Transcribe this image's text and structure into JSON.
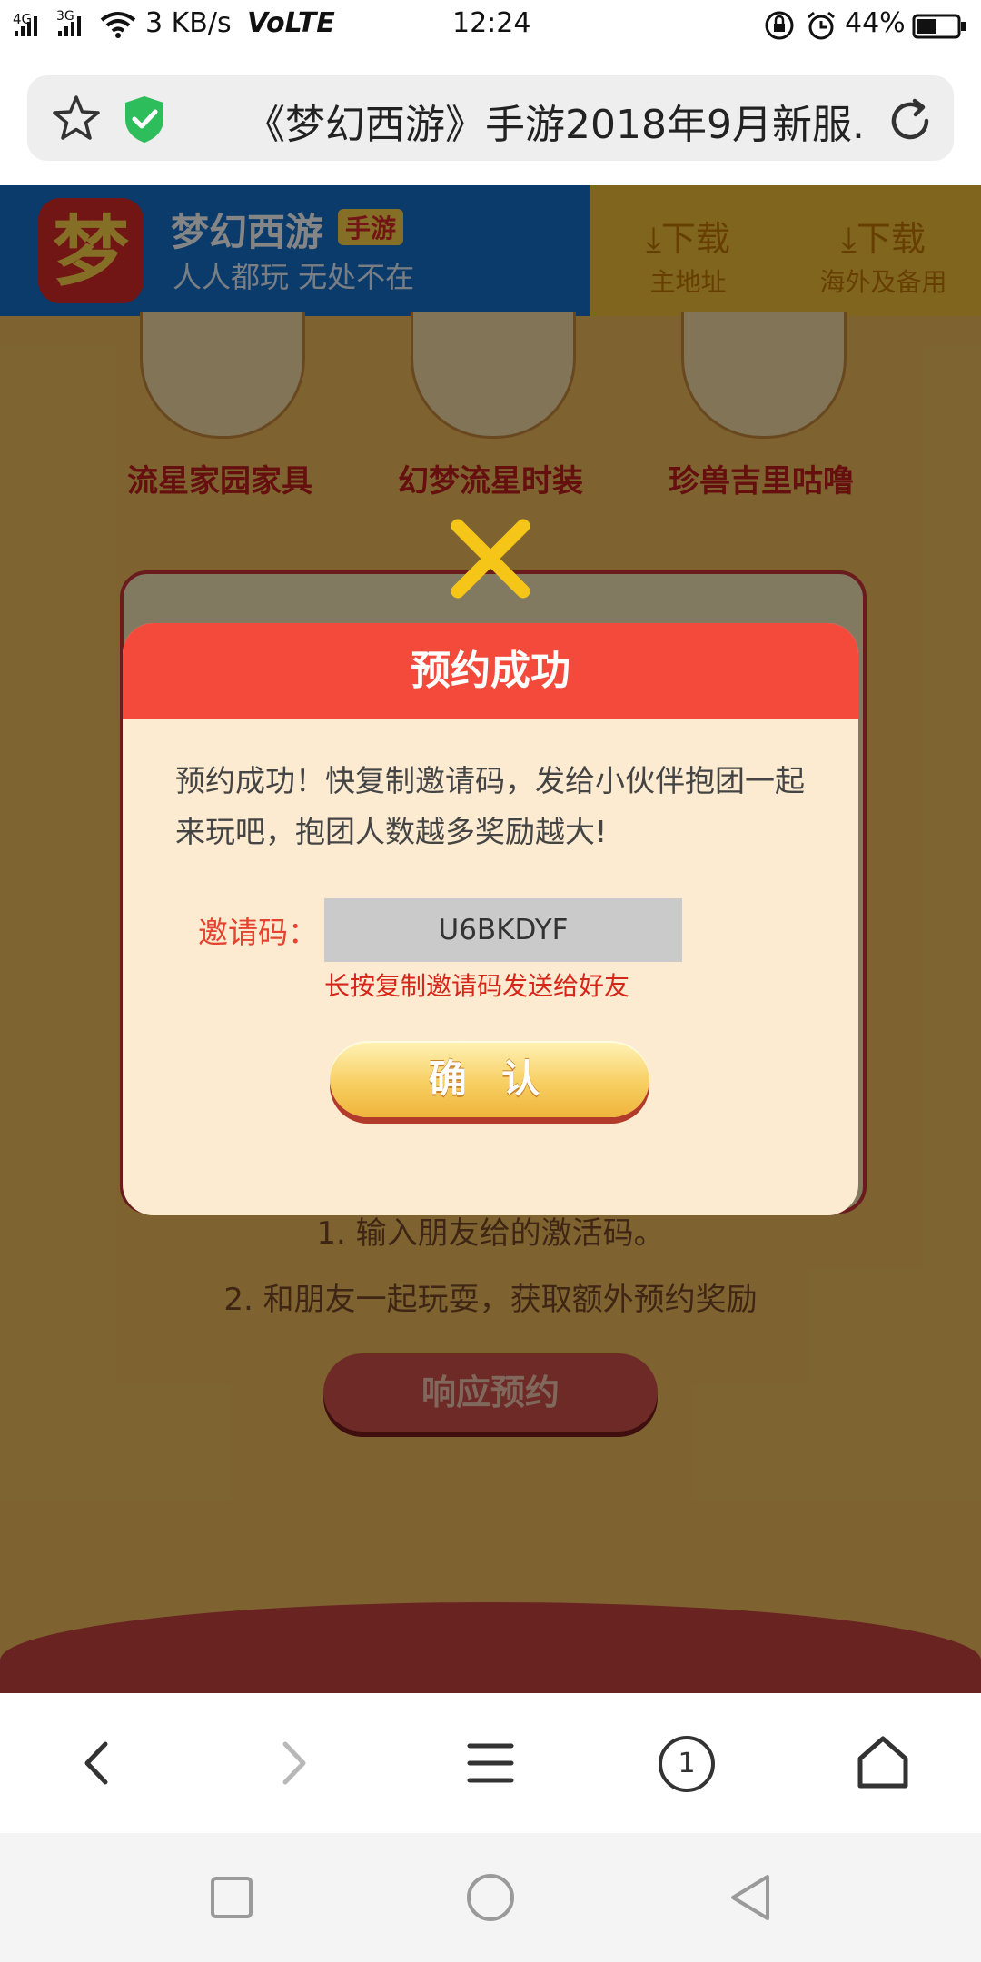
{
  "status_bar": {
    "network_left": "4G",
    "network_right": "3G",
    "speed": "3 KB/s",
    "volte": "VoLTE",
    "time": "12:24",
    "battery": "44%",
    "icons": [
      "signal-icon",
      "wifi-icon",
      "rotation-lock-icon",
      "alarm-icon",
      "battery-icon"
    ]
  },
  "browser": {
    "url_title": "《梦幻西游》手游2018年9月新服...",
    "icons": [
      "star-icon",
      "shield-check-icon",
      "refresh-icon"
    ],
    "shield_color": "#2dbd5b"
  },
  "page": {
    "app_name": "梦幻西游",
    "app_badge": "手游",
    "app_slogan": "人人都玩 无处不在",
    "download_main": {
      "label": "下载",
      "sub": "主地址"
    },
    "download_alt": {
      "label": "下载",
      "sub": "海外及备用"
    },
    "prizes": [
      "流星家园家具",
      "幻梦流星时装",
      "珍兽吉里咕噜"
    ],
    "steps": [
      "1. 输入朋友给的激活码。",
      "2. 和朋友一起玩耍，获取额外预约奖励"
    ],
    "respond_button": "响应预约"
  },
  "dialog": {
    "title": "预约成功",
    "message": "预约成功！快复制邀请码，发给小伙伴抱团一起来玩吧，抱团人数越多奖励越大!",
    "code_label": "邀请码：",
    "code_value": "U6BKDYF",
    "code_hint": "长按复制邀请码发送给好友",
    "confirm_button": "确 认",
    "header_color": "#f34a3b"
  },
  "bottom_nav": {
    "tab_count": "1",
    "icons": [
      "back-icon",
      "forward-icon",
      "menu-icon",
      "tabs-icon",
      "home-icon"
    ]
  },
  "system_nav": {
    "icons": [
      "recents-icon",
      "home-circle-icon",
      "back-triangle-icon"
    ]
  }
}
